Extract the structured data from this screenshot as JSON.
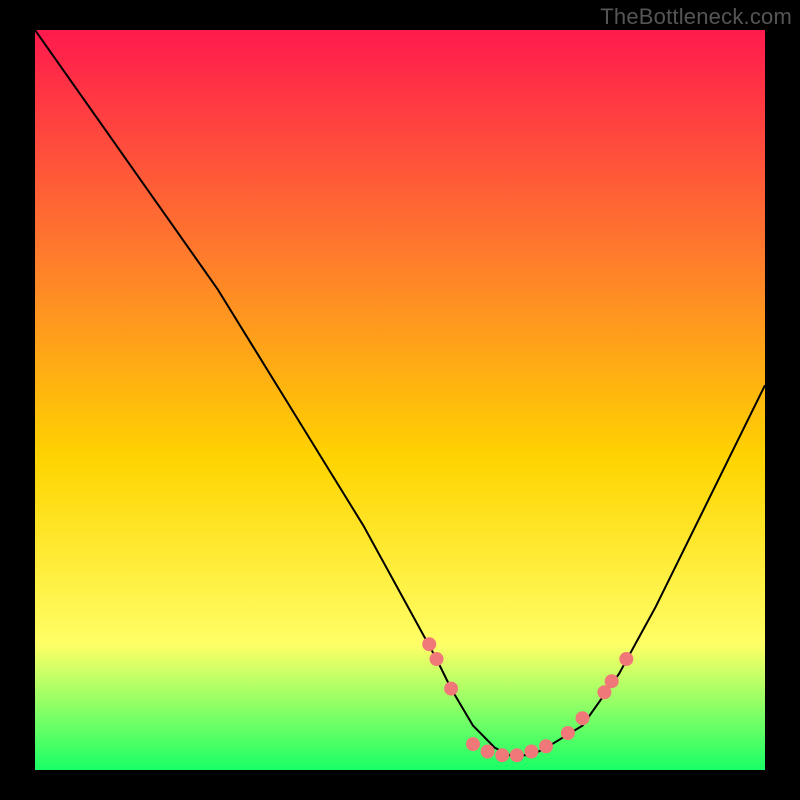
{
  "watermark": "TheBottleneck.com",
  "chart_data": {
    "type": "line",
    "title": "",
    "xlabel": "",
    "ylabel": "",
    "xlim": [
      0,
      100
    ],
    "ylim": [
      0,
      100
    ],
    "x": [
      0,
      5,
      10,
      15,
      20,
      25,
      30,
      35,
      40,
      45,
      50,
      55,
      57,
      60,
      63,
      65,
      68,
      70,
      75,
      80,
      85,
      90,
      95,
      100
    ],
    "values": [
      100,
      93,
      86,
      79,
      72,
      65,
      57,
      49,
      41,
      33,
      24,
      15,
      11,
      6,
      3,
      2,
      2,
      3,
      6,
      13,
      22,
      32,
      42,
      52
    ],
    "marker_points": [
      {
        "x": 54,
        "y": 17
      },
      {
        "x": 55,
        "y": 15
      },
      {
        "x": 57,
        "y": 11
      },
      {
        "x": 60,
        "y": 3.5
      },
      {
        "x": 62,
        "y": 2.5
      },
      {
        "x": 64,
        "y": 2
      },
      {
        "x": 66,
        "y": 2
      },
      {
        "x": 68,
        "y": 2.5
      },
      {
        "x": 70,
        "y": 3.2
      },
      {
        "x": 73,
        "y": 5
      },
      {
        "x": 75,
        "y": 7
      },
      {
        "x": 78,
        "y": 10.5
      },
      {
        "x": 79,
        "y": 12
      },
      {
        "x": 81,
        "y": 15
      }
    ],
    "colors": {
      "gradient_top": "#ff1a4d",
      "gradient_mid_upper": "#ff7a2d",
      "gradient_mid": "#ffd400",
      "gradient_low": "#ffff66",
      "gradient_bottom": "#19ff66",
      "curve": "#000000",
      "marker": "#f07878"
    }
  }
}
